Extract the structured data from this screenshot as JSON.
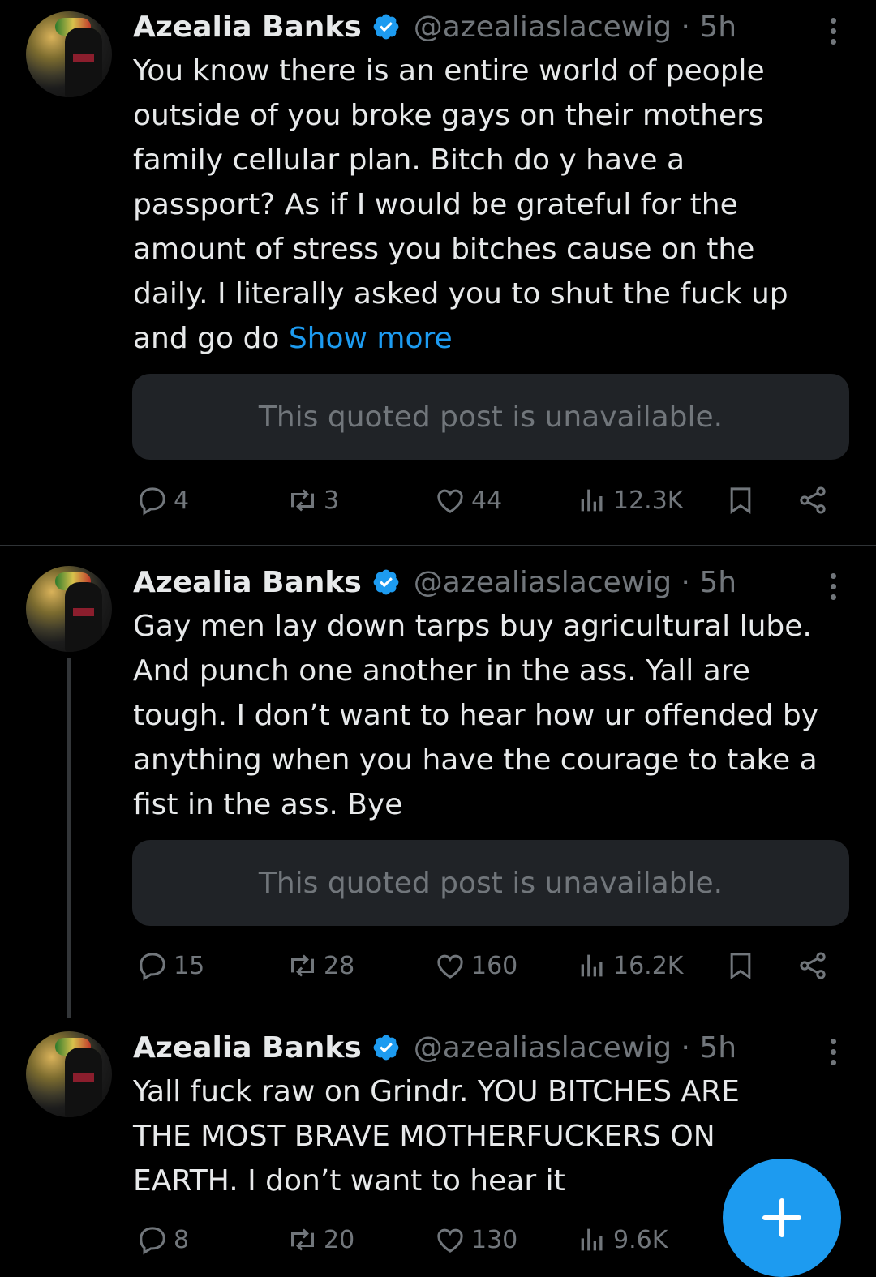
{
  "tweets": [
    {
      "name": "Azealia Banks",
      "handle": "@azealiaslacewig · 5h",
      "lines": [
        "You know there is an entire world of people",
        "outside of you broke gays on their mothers",
        "family cellular plan. Bitch do y have a",
        "passport? As if I would be grateful for the",
        "amount of stress you bitches cause on the",
        "daily. I literally asked you to shut the fuck up",
        "and go do "
      ],
      "show_more": "Show more",
      "quoted": "This quoted post is unavailable.",
      "replies": "4",
      "reposts": "3",
      "likes": "44",
      "views": "12.3K"
    },
    {
      "name": "Azealia Banks",
      "handle": "@azealiaslacewig · 5h",
      "lines": [
        "Gay men lay down tarps buy agricultural lube.",
        "And punch one another in the ass. Yall are",
        "tough. I don’t want to hear how ur offended by",
        "anything when you have the courage to take a",
        "fist in the ass. Bye"
      ],
      "quoted": "This quoted post is unavailable.",
      "replies": "15",
      "reposts": "28",
      "likes": "160",
      "views": "16.2K"
    },
    {
      "name": "Azealia Banks",
      "handle": "@azealiaslacewig · 5h",
      "lines": [
        "Yall fuck raw on Grindr. YOU BITCHES ARE",
        "THE MOST BRAVE MOTHERFUCKERS ON",
        "EARTH. I don’t want to hear it"
      ],
      "replies": "8",
      "reposts": "20",
      "likes": "130",
      "views": "9.6K"
    }
  ],
  "colors": {
    "background": "#000000",
    "text": "#e7e9ea",
    "secondary": "#71767b",
    "accent": "#1d9bf0",
    "quoted_bg": "#202327"
  },
  "icons": [
    "verified-badge-icon",
    "more-options-icon",
    "reply-icon",
    "repost-icon",
    "like-icon",
    "views-icon",
    "bookmark-icon",
    "share-icon",
    "compose-plus-icon"
  ]
}
